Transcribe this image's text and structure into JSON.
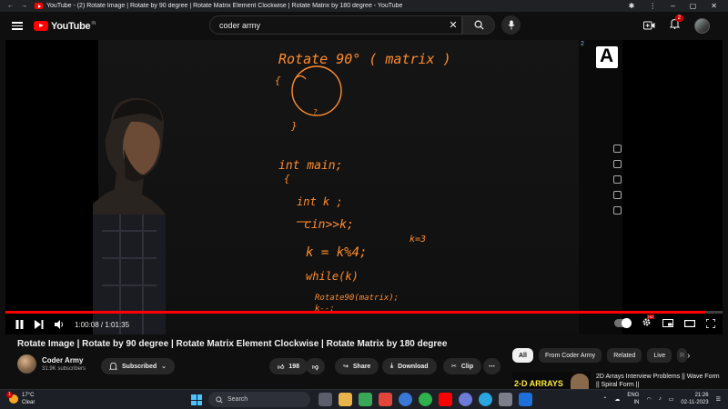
{
  "browser": {
    "tab_title": "YouTube - (2) Rotate Image | Rotate by 90 degree | Rotate Matrix Element Clockwise | Rotate Matrix by 180 degree - YouTube"
  },
  "header": {
    "logo_text": "YouTube",
    "country_code": "IN",
    "search_value": "coder army",
    "notification_count": "2"
  },
  "player": {
    "current_time": "1:00:08",
    "duration": "1:01:35",
    "time_separator": " / ",
    "progress": 0.976,
    "view_count_partial": "2",
    "board": {
      "title": "Rotate 90° ( matrix )",
      "brace_open": "{",
      "brace_close": "}",
      "inner_mark": "?",
      "line1": "int   main;",
      "line2": "{",
      "line3": "int k ;",
      "line4": "cin>>k;",
      "line5": "k = k%4;",
      "line6": "while(k)",
      "line7": "Rotate90(matrix);",
      "line8": "k--;",
      "note": "k=3"
    }
  },
  "video": {
    "title": "Rotate Image | Rotate by 90 degree | Rotate Matrix Element Clockwise | Rotate Matrix by 180 degree",
    "channel_name": "Coder Army",
    "subscribers": "31.9K subscribers",
    "subscribed_label": "Subscribed",
    "likes": "198",
    "share_label": "Share",
    "download_label": "Download",
    "clip_label": "Clip"
  },
  "recommendations": {
    "chips": [
      "All",
      "From Coder Army",
      "Related",
      "Live",
      "R"
    ],
    "first": {
      "thumb_text": "2-D ARRAYS",
      "title": "2D Arrays Interview Problems || Wave Form || Spiral Form ||"
    }
  },
  "taskbar": {
    "temperature": "17°C",
    "weather": "Clear",
    "weather_badge": "1",
    "search_label": "Search",
    "lang_1": "ENG",
    "lang_2": "IN",
    "time": "21:26",
    "date": "02-11-2023"
  },
  "colors": {
    "youtube_red": "#ff0000",
    "chalk_orange": "#ff8c2e",
    "background": "#0f0f0f"
  }
}
